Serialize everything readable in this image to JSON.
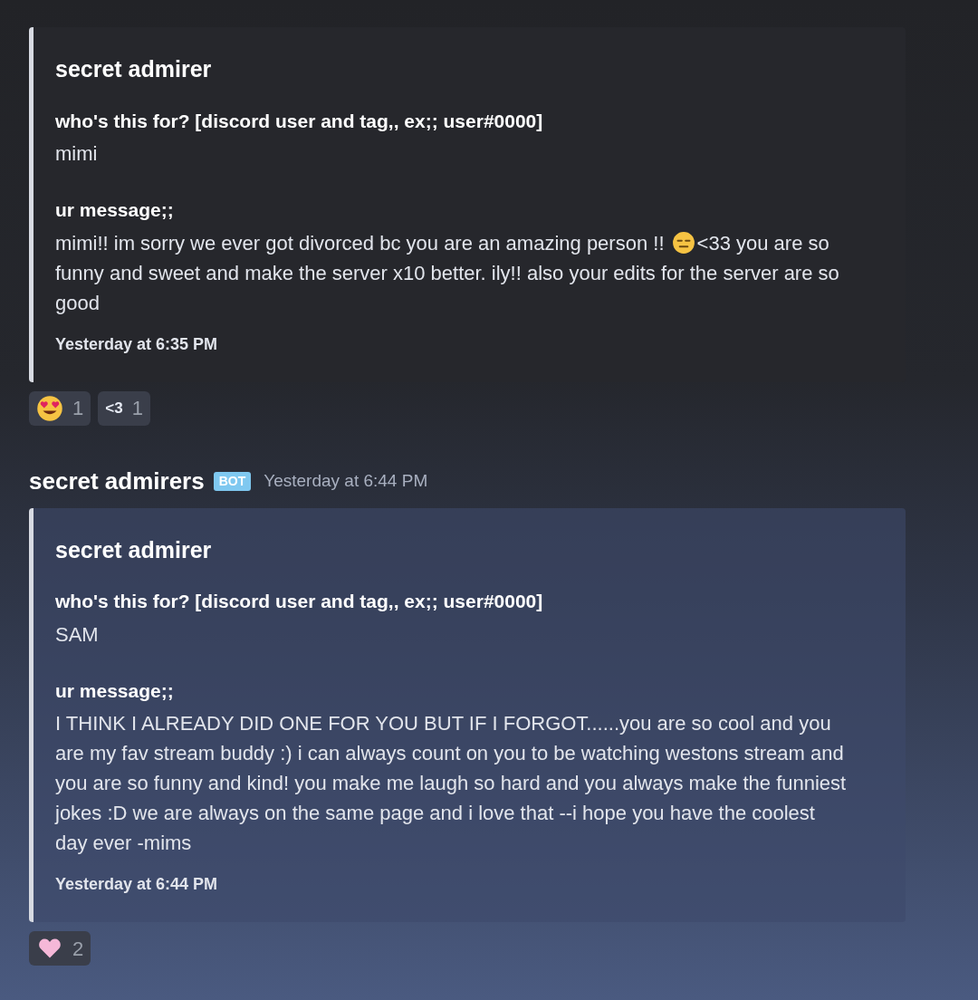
{
  "messages": [
    {
      "embed": {
        "title": "secret admirer",
        "fields": [
          {
            "name": "who's this for? [discord user and tag,, ex;; user#0000]",
            "parts": [
              {
                "kind": "text",
                "text": "mimi"
              }
            ]
          },
          {
            "name": "ur message;;",
            "parts": [
              {
                "kind": "text",
                "text": "mimi!! im sorry we ever got divorced bc you are an amazing person !! "
              },
              {
                "kind": "emoji"
              },
              {
                "kind": "text",
                "text": "<33 you are so funny and sweet and make the server x10 better. ily!! also your edits for the server are so good"
              }
            ]
          }
        ],
        "footer": "Yesterday at 6:35 PM"
      },
      "reactions": [
        {
          "kind": "heart-eyes",
          "count": "1"
        },
        {
          "kind": "text",
          "label": "<3",
          "count": "1"
        }
      ]
    },
    {
      "header": {
        "author": "secret admirers",
        "badge": "BOT",
        "time": "Yesterday at 6:44 PM"
      },
      "embed": {
        "title": "secret admirer",
        "fields": [
          {
            "name": "who's this for? [discord user and tag,, ex;; user#0000]",
            "parts": [
              {
                "kind": "text",
                "text": "SAM"
              }
            ]
          },
          {
            "name": "ur message;;",
            "parts": [
              {
                "kind": "text",
                "text": "I THINK I ALREADY DID ONE FOR YOU BUT IF I FORGOT......you are so cool and you are my fav stream buddy :) i can always count on you to be watching westons stream and you are so funny and kind! you make me laugh so hard and you always make the funniest jokes :D we are always on the same page and i love that --i hope you have the coolest day ever -mims"
              }
            ]
          }
        ],
        "footer": "Yesterday at 6:44 PM"
      },
      "reactions": [
        {
          "kind": "heart",
          "count": "2"
        }
      ]
    }
  ]
}
